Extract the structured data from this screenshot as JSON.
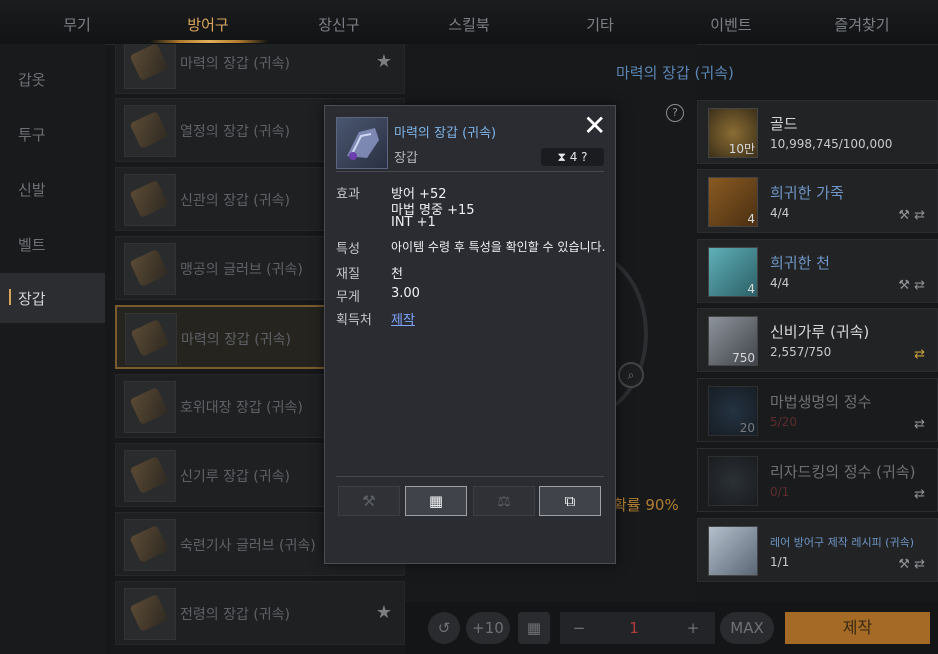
{
  "tabs": [
    {
      "label": "무기",
      "active": false
    },
    {
      "label": "방어구",
      "active": true
    },
    {
      "label": "장신구",
      "active": false
    },
    {
      "label": "스킬북",
      "active": false
    },
    {
      "label": "기타",
      "active": false
    },
    {
      "label": "이벤트",
      "active": false
    },
    {
      "label": "즐겨찾기",
      "active": false
    }
  ],
  "sidebar": {
    "items": [
      {
        "label": "갑옷"
      },
      {
        "label": "투구"
      },
      {
        "label": "신발"
      },
      {
        "label": "벨트"
      },
      {
        "label": "장갑"
      }
    ],
    "active": "장갑"
  },
  "recipe_list": [
    {
      "name": "마력의 장갑 (귀속)",
      "starred": true
    },
    {
      "name": "열정의 장갑 (귀속)",
      "starred": false
    },
    {
      "name": "신관의 장갑 (귀속)",
      "starred": false
    },
    {
      "name": "맹공의 글러브 (귀속)",
      "starred": false
    },
    {
      "name": "마력의 장갑 (귀속)",
      "starred": false
    },
    {
      "name": "호위대장 장갑 (귀속)",
      "starred": false
    },
    {
      "name": "신기루 장갑 (귀속)",
      "starred": false
    },
    {
      "name": "숙련기사 글러브 (귀속)",
      "starred": false
    },
    {
      "name": "전령의 장갑 (귀속)",
      "starred": true
    }
  ],
  "center": {
    "title": "마력의 장갑 (귀속)",
    "help": "?",
    "success_rate": "확률 90%",
    "zoom_icon": "magnifier-icon"
  },
  "materials": [
    {
      "name": "골드",
      "count": "10,998,745/100,000",
      "qty": "10만",
      "blue": false,
      "dim": false,
      "red": false
    },
    {
      "name": "희귀한 가죽",
      "count": "4/4",
      "qty": "4",
      "blue": true,
      "dim": false,
      "red": false
    },
    {
      "name": "희귀한 천",
      "count": "4/4",
      "qty": "4",
      "blue": true,
      "dim": false,
      "red": false
    },
    {
      "name": "신비가루 (귀속)",
      "count": "2,557/750",
      "qty": "750",
      "blue": false,
      "dim": false,
      "red": false
    },
    {
      "name": "마법생명의 정수",
      "count": "5/20",
      "qty": "20",
      "blue": false,
      "dim": true,
      "red": true
    },
    {
      "name": "리자드킹의 정수 (귀속)",
      "count": "0/1",
      "qty": "",
      "blue": false,
      "dim": true,
      "red": true
    },
    {
      "name": "레어 방어구 제작 레시피 (귀속)",
      "count": "1/1",
      "qty": "",
      "blue": true,
      "dim": false,
      "red": false
    }
  ],
  "bottom": {
    "undo": "↺",
    "plus10": "+10",
    "calc": "▦",
    "minus": "−",
    "qty": "1",
    "plus": "+",
    "max": "MAX",
    "make": "제작"
  },
  "tooltip": {
    "title": "마력의 장갑 (귀속)",
    "type": "장갑",
    "close": "✕",
    "badge": "4 ?",
    "stats_label": "효과",
    "stats": [
      "방어 +52",
      "마법 명중 +15",
      "INT +1"
    ],
    "trait_label": "특성",
    "trait": "아이템 수령 후 특성을 확인할 수 있습니다.",
    "material_label": "재질",
    "material": "천",
    "weight_label": "무게",
    "weight": "3.00",
    "source_label": "획득처",
    "source": "제작"
  }
}
